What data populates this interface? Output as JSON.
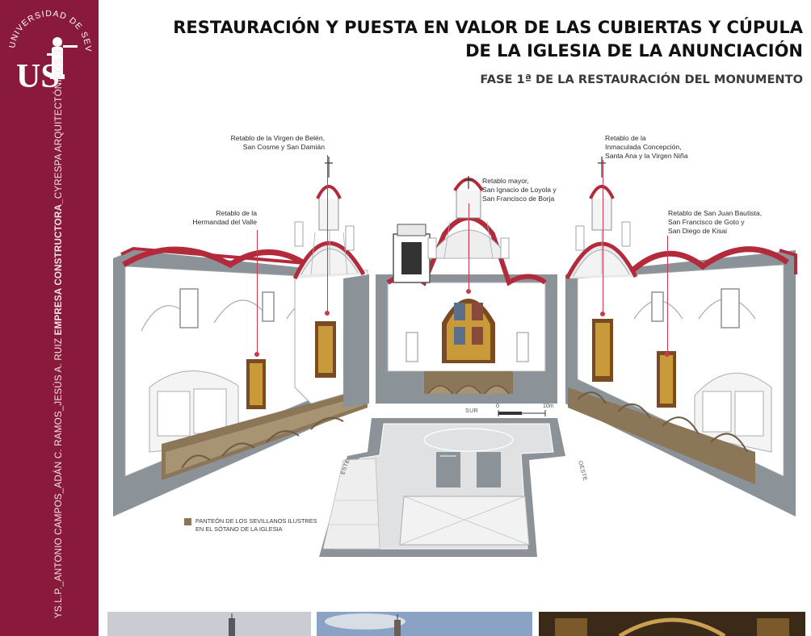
{
  "university": {
    "top_arc_text": "UNIVERSIDAD DE SEVILLA",
    "monogram": "US"
  },
  "credits": {
    "people": "YS.L.P._ANTONIO CAMPOS_ADÁN C. RAMOS_JESÚS A. RUIZ",
    "company_bold": "EMPRESA CONSTRUCTORA_",
    "company": "CYRESPA ARQUITECTÓNICOS S.L."
  },
  "header": {
    "title_line1": "RESTAURACIÓN Y PUESTA EN VALOR DE LAS CUBIERTAS Y CÚPULA",
    "title_line2": "DE LA IGLESIA DE LA ANUNCIACIÓN",
    "subtitle": "FASE 1ª DE LA RESTAURACIÓN DEL MONUMENTO"
  },
  "annotations": {
    "virgen_belen": [
      "Retablo de la Virgen de Belén,",
      "San Cosme y San Damián"
    ],
    "hermandad": [
      "Retablo de la",
      "Hermandad del Valle"
    ],
    "mayor": [
      "Retablo mayor,",
      "San Ignacio de Loyola y",
      "San Francisco de Borja"
    ],
    "inmaculada": [
      "Retablo de la",
      "Inmaculada Concepción,",
      "Santa Ana y la Virgen Niña"
    ],
    "san_juan": [
      "Retablo de San Juan Bautista,",
      "San Francisco de Goto y",
      "San Diego de Kisai"
    ]
  },
  "plan": {
    "orientation_south": "SUR",
    "orientation_east": "ESTE",
    "orientation_west": "OESTE",
    "scale_start": "0",
    "scale_end": "10m"
  },
  "legend": {
    "line1": "PANTEÓN DE LOS SEVILLANOS ILUSTRES",
    "line2": "EN EL SÓTANO DE LA IGLESIA"
  },
  "colors": {
    "band": "#8a1a3c",
    "vault_red": "#b32b3b",
    "wall_gray": "#8b9298",
    "crypt_brown": "#8b7758",
    "leader_red": "#c7394b"
  }
}
